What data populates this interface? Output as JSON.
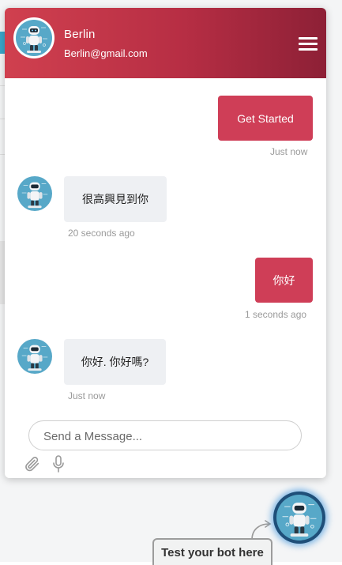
{
  "header": {
    "name": "Berlin",
    "email": "Berlin@gmail.com",
    "menu_icon": "hamburger-menu-icon",
    "avatar_icon": "robot-avatar-icon"
  },
  "messages": [
    {
      "sender": "user",
      "text": "Get Started",
      "time": "Just now"
    },
    {
      "sender": "bot",
      "text": "很高興見到你",
      "time": "20 seconds ago"
    },
    {
      "sender": "user",
      "text": "你好",
      "time": "1 seconds ago"
    },
    {
      "sender": "bot",
      "text": "你好. 你好嗎?",
      "time": "Just now"
    }
  ],
  "composer": {
    "placeholder": "Send a Message...",
    "value": "",
    "attach_icon": "paperclip-icon",
    "mic_icon": "microphone-icon"
  },
  "launcher": {
    "tooltip": "Test your bot here",
    "icon": "robot-avatar-icon"
  },
  "colors": {
    "header_start": "#d0404f",
    "header_end": "#8d2036",
    "user_bubble": "#cf3e57",
    "bot_bubble": "#eef0f3",
    "avatar_bg": "#57a8c8"
  }
}
